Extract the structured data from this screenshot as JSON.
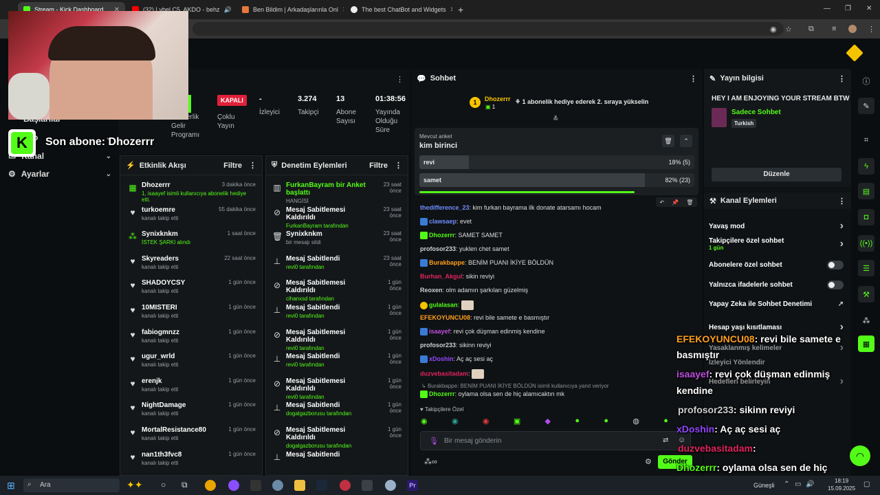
{
  "browser": {
    "tabs": [
      {
        "label": "Stream - Kick Dashboard",
        "active": true
      },
      {
        "label": "(32) Lvbel C5, AKDO - behz",
        "active": false
      },
      {
        "label": "Ben Bildim | Arkadaşlarınla Onl",
        "active": false
      },
      {
        "label": "The best ChatBot and Widgets",
        "active": false
      }
    ],
    "new_tab": "+",
    "window_controls": [
      "—",
      "❐",
      "✕"
    ]
  },
  "overlay": {
    "last_sub": "Son abone: Dhozerrr",
    "logo_letter": "K"
  },
  "leftnav": {
    "items": [
      {
        "label": "Başlarılar"
      },
      {
        "label": "Kanal"
      },
      {
        "label": "Ayarlar"
      }
    ],
    "partial": "dyo"
  },
  "stats": {
    "partial_label": [
      "erlik",
      "Gelir",
      "Programı"
    ],
    "status_badge": "KAPALI",
    "multi_stream": [
      "Çoklu",
      "Yayın"
    ],
    "items": [
      {
        "value": "-",
        "label": "İzleyici"
      },
      {
        "value": "3.274",
        "label": "Takipçi"
      },
      {
        "value": "13",
        "label": "Abone Sayısı"
      },
      {
        "value": "01:38:56",
        "label": "Yayında Olduğu Süre"
      }
    ]
  },
  "activity": {
    "title": "Etkinlik Akışı",
    "filter": "Filtre",
    "rows": [
      {
        "name": "Dhozerrr",
        "time": "3 dakika önce",
        "sub": "1, isaayef isimli kullanıcıya abonelik hediye etti.",
        "icon": "gift-icon",
        "highlight": true
      },
      {
        "name": "turkoemre",
        "time": "55 dakika önce",
        "sub": "kanalı takip etti",
        "icon": "heart-icon"
      },
      {
        "name": "Synixknkm",
        "time": "1 saat önce",
        "sub": "İSTEK ŞARKI alındı",
        "icon": "bubbles-icon",
        "highlight": true
      },
      {
        "name": "Skyreaders",
        "time": "22 saat önce",
        "sub": "kanalı takip etti",
        "icon": "heart-icon"
      },
      {
        "name": "SHADOYCSY",
        "time": "1 gün önce",
        "sub": "kanalı takip etti",
        "icon": "heart-icon"
      },
      {
        "name": "10MISTERI",
        "time": "1 gün önce",
        "sub": "kanalı takip etti",
        "icon": "heart-icon"
      },
      {
        "name": "fabiogmnzz",
        "time": "1 gün önce",
        "sub": "kanalı takip etti",
        "icon": "heart-icon"
      },
      {
        "name": "ugur_wrld",
        "time": "1 gün önce",
        "sub": "kanalı takip etti",
        "icon": "heart-icon"
      },
      {
        "name": "erenjk",
        "time": "1 gün önce",
        "sub": "kanalı takip etti",
        "icon": "heart-icon"
      },
      {
        "name": "NightDamage",
        "time": "1 gün önce",
        "sub": "kanalı takip etti",
        "icon": "heart-icon"
      },
      {
        "name": "MortalResistance80",
        "time": "1 gün önce",
        "sub": "kanalı takip etti",
        "icon": "heart-icon"
      },
      {
        "name": "nan1th3fvc8",
        "time": "1 gün önce",
        "sub": "kanalı takip etti",
        "icon": "heart-icon"
      }
    ]
  },
  "moderation": {
    "title": "Denetim Eylemleri",
    "filter": "Filtre",
    "rows": [
      {
        "name": "FurkanBayram bir Anket başlattı",
        "time": "23 saat önce",
        "sub": "HANGİSİ",
        "icon": "poll-icon"
      },
      {
        "name": "Mesaj Sabitlemesi Kaldırıldı",
        "time": "23 saat önce",
        "sub": "FurkanBayram tarafından",
        "icon": "unpin-icon"
      },
      {
        "name": "Synixknkm",
        "time": "23 saat önce",
        "sub": "bir mesajı sildi",
        "icon": "trash-icon"
      },
      {
        "name": "Mesaj Sabitlendi",
        "time": "23 saat önce",
        "sub": "revi0 tarafından",
        "icon": "pin-icon"
      },
      {
        "name": "Mesaj Sabitlemesi Kaldırıldı",
        "time": "1 gün önce",
        "sub": "cihanxsd tarafından",
        "icon": "unpin-icon"
      },
      {
        "name": "Mesaj Sabitlendi",
        "time": "1 gün önce",
        "sub": "revi0 tarafından",
        "icon": "pin-icon"
      },
      {
        "name": "Mesaj Sabitlemesi Kaldırıldı",
        "time": "1 gün önce",
        "sub": "revi0 tarafından",
        "icon": "unpin-icon"
      },
      {
        "name": "Mesaj Sabitlendi",
        "time": "1 gün önce",
        "sub": "revi0 tarafından",
        "icon": "pin-icon"
      },
      {
        "name": "Mesaj Sabitlemesi Kaldırıldı",
        "time": "1 gün önce",
        "sub": "revi0 tarafından",
        "icon": "unpin-icon"
      },
      {
        "name": "Mesaj Sabitlendi",
        "time": "1 gün önce",
        "sub": "dogalgazborusu tarafından",
        "icon": "pin-icon"
      },
      {
        "name": "Mesaj Sabitlemesi Kaldırıldı",
        "time": "1 gün önce",
        "sub": "dogalgazborusu tarafından",
        "icon": "unpin-icon"
      },
      {
        "name": "Mesaj Sabitlendi",
        "time": "",
        "sub": "",
        "icon": "pin-icon"
      }
    ]
  },
  "chat": {
    "title": "Sohbet",
    "top_gifter": {
      "name": "Dhozerrr",
      "count": "1",
      "rank": "1"
    },
    "gift_hint": "1 abonelik hediye ederek 2. sıraya yükselin",
    "poll": {
      "label": "Mevcut anket",
      "question": "kim birinci",
      "options": [
        {
          "name": "revi",
          "result": "18% (5)",
          "percent": 18
        },
        {
          "name": "samet",
          "result": "82% (23)",
          "percent": 82
        }
      ]
    },
    "messages": [
      {
        "user": "thedifference_23",
        "text": "kim furkan bayrama ilk donate atarsamı hocam",
        "color": "#6f8cff"
      },
      {
        "user": "clawsaep",
        "text": "evet",
        "color": "#6f8cff"
      },
      {
        "user": "Dhozerrr",
        "text": "SAMET SAMET",
        "color": "#53fc18"
      },
      {
        "user": "profosor233",
        "text": "yuklen chet samet",
        "color": "#cfcfcf"
      },
      {
        "user": "Burakbappe",
        "text": "BENİM PUANI İKİYE BÖLDÜN",
        "color": "#ff9f1c"
      },
      {
        "user": "Burhan_Akgul",
        "text": "sikin reviyi",
        "color": "#e0245e"
      },
      {
        "user": "Reoxen",
        "text": "olm adamın şarkıları güzelmiş",
        "color": "#cfcfcf"
      },
      {
        "user": "gulalasan",
        "text": "",
        "color": "#53fc18"
      },
      {
        "user": "EFEKOYUNCU08",
        "text": "revi bile samete e basmıştır",
        "color": "#ff9f1c"
      },
      {
        "user": "isaayef",
        "text": "revi çok düşman edinmiş kendine",
        "color": "#c04ee0"
      },
      {
        "user": "profosor233",
        "text": "sikinn reviyi",
        "color": "#cfcfcf"
      },
      {
        "user": "xDoshin",
        "text": "Aç aç sesi aç",
        "color": "#9146ff"
      },
      {
        "user": "duzvebasitadam",
        "text": "",
        "color": "#e0245e"
      },
      {
        "user": "Dhozerrr",
        "text": "oylama olsa sen de hiç alamıcaktın mk",
        "color": "#53fc18"
      }
    ],
    "reply_note": "Burakbappe: BENİM PUANI İKİYE BÖLDÜN isimli kullanıcıya yanıt veriyor",
    "followers_only": "Takipçilere Özel",
    "input_placeholder": "Bir mesaj gönderin",
    "send": "Gönder"
  },
  "stream_info": {
    "title": "Yayın bilgisi",
    "stream_title": "HEY I AM ENJOYING YOUR STREAM BTW",
    "category": "Sadece Sohbet",
    "language": "Turkish",
    "edit": "Düzenle"
  },
  "channel_actions": {
    "title": "Kanal Eylemleri",
    "items": [
      {
        "label": "Yavaş mod",
        "type": "chevron"
      },
      {
        "label": "Takipçilere özel sohbet",
        "sub": "1 gün",
        "type": "chevron"
      },
      {
        "label": "Abonelere özel sohbet",
        "type": "toggle"
      },
      {
        "label": "Yalnızca ifadelerle sohbet",
        "type": "toggle"
      },
      {
        "label": "Yapay Zeka ile Sohbet Denetimi",
        "type": "external"
      },
      {
        "label": "Hesap yaşı kısıtlaması",
        "type": "chevron"
      },
      {
        "label": "Yasaklanmış kelimeler",
        "type": "chevron"
      },
      {
        "label": "İzleyici Yönlendir",
        "type": "none"
      },
      {
        "label": "Hedefleri belirleyin",
        "type": "chevron"
      }
    ]
  },
  "stream_overlay_chat": [
    {
      "user": "EFEKOYUNCU08",
      "text": ": revi bile samete e",
      "user_color": "#ff9f1c"
    },
    {
      "user": "",
      "text": "basmıştır",
      "user_color": "#fff"
    },
    {
      "user": "isaayef",
      "text": ": revi çok düşman edinmiş",
      "user_color": "#c04ee0"
    },
    {
      "user": "",
      "text": "kendine",
      "user_color": "#fff"
    },
    {
      "user": "profosor233",
      "text": ": sikinn reviyi",
      "user_color": "#cfcfcf"
    },
    {
      "user": "xDoshin",
      "text": ": Aç aç sesi aç",
      "user_color": "#9146ff"
    },
    {
      "user": "duzvebasitadam",
      "text": ":",
      "user_color": "#e0245e"
    },
    {
      "user": "Dhozerrr",
      "text": ": oylama olsa sen de hiç",
      "user_color": "#53fc18"
    },
    {
      "user": "",
      "text": "alamıcaktın mk",
      "user_color": "#fff"
    }
  ],
  "taskbar": {
    "search": "Ara",
    "weather": "Güneşli",
    "time": "18:19",
    "date": "15.09.2025"
  }
}
